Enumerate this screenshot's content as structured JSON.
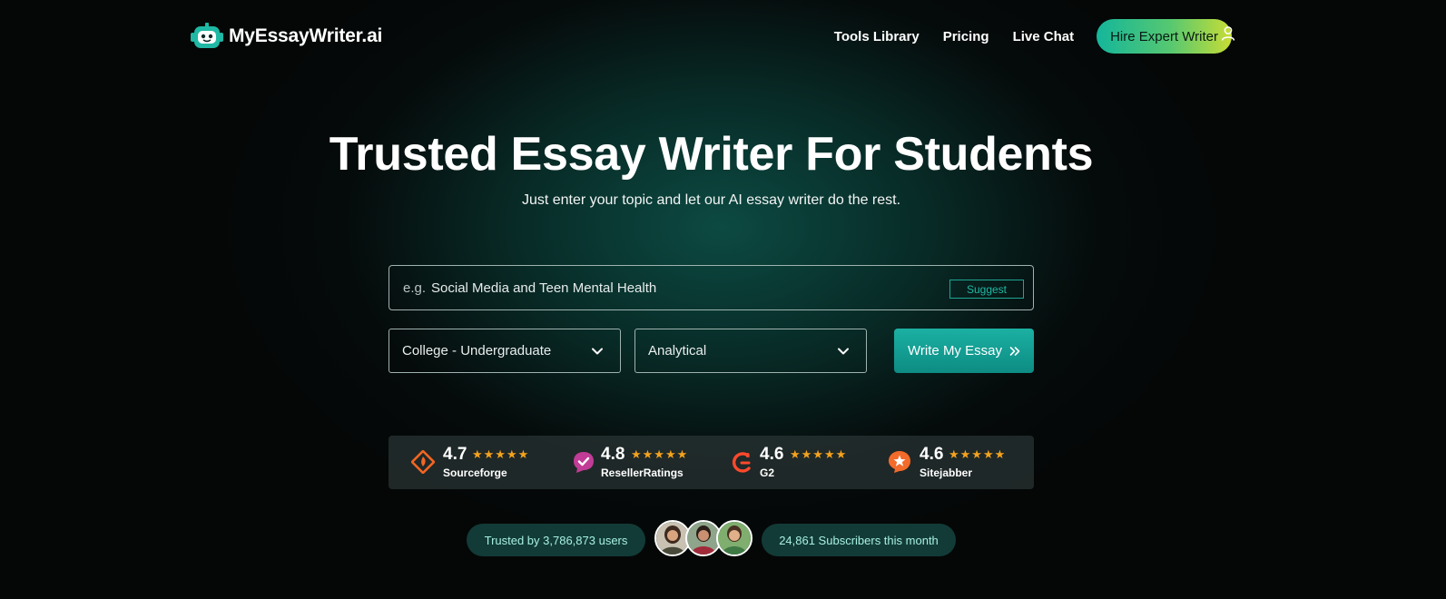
{
  "brand": {
    "name": "MyEssayWriter.ai"
  },
  "nav": {
    "links": [
      "Tools Library",
      "Pricing",
      "Live Chat"
    ],
    "cta": "Hire Expert Writer"
  },
  "hero": {
    "title": "Trusted Essay Writer For Students",
    "subtitle": "Just enter your topic and let our AI essay writer do the rest."
  },
  "form": {
    "topic_prefix": "e.g.",
    "topic_placeholder": "Social Media and Teen Mental Health",
    "suggest_label": "Suggest",
    "level_value": "College - Undergraduate",
    "type_value": "Analytical",
    "submit_label": "Write My Essay"
  },
  "ratings": [
    {
      "score": "4.7",
      "stars": "★★★★★",
      "name": "Sourceforge",
      "icon": "sourceforge-icon",
      "color": "#f26622"
    },
    {
      "score": "4.8",
      "stars": "★★★★★",
      "name": "ResellerRatings",
      "icon": "resellerratings-icon",
      "color": "#c13c97"
    },
    {
      "score": "4.6",
      "stars": "★★★★★",
      "name": "G2",
      "icon": "g2-icon",
      "color": "#ff492c"
    },
    {
      "score": "4.6",
      "stars": "★★★★★",
      "name": "Sitejabber",
      "icon": "sitejabber-icon",
      "color": "#f26b2a"
    }
  ],
  "trust": {
    "users": "Trusted by 3,786,873 users",
    "subscribers": "24,861 Subscribers this month"
  },
  "colors": {
    "accent": "#1bb0a3",
    "star": "#f4a21e",
    "cta_gradient_start": "#14b69b",
    "cta_gradient_end": "#c8dd35"
  }
}
